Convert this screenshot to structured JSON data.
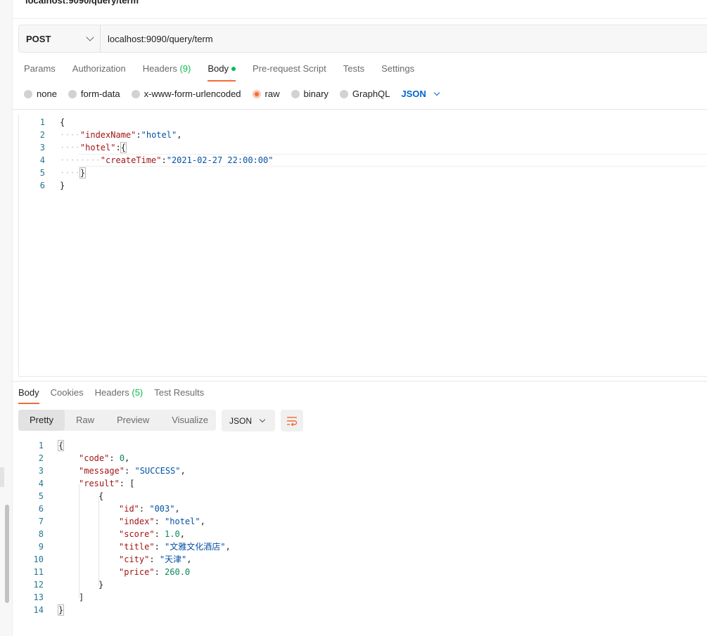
{
  "request_title": "localhost:9090/query/term",
  "request": {
    "method": "POST",
    "url": "localhost:9090/query/term"
  },
  "request_tabs": {
    "params": "Params",
    "authorization": "Authorization",
    "headers_label": "Headers",
    "headers_count": "(9)",
    "body": "Body",
    "prerequest": "Pre-request Script",
    "tests": "Tests",
    "settings": "Settings"
  },
  "body_types": {
    "none": "none",
    "form_data": "form-data",
    "urlencoded": "x-www-form-urlencoded",
    "raw": "raw",
    "binary": "binary",
    "graphql": "GraphQL",
    "selected": "raw",
    "format": "JSON"
  },
  "request_body_lines": [
    {
      "n": "1"
    },
    {
      "n": "2"
    },
    {
      "n": "3"
    },
    {
      "n": "4"
    },
    {
      "n": "5"
    },
    {
      "n": "6"
    }
  ],
  "request_body": {
    "key_indexName": "\"indexName\"",
    "val_indexName": "\"hotel\"",
    "key_hotel": "\"hotel\"",
    "key_createTime": "\"createTime\"",
    "val_createTime": "\"2021-02-27 22:00:00\""
  },
  "response_tabs": {
    "body": "Body",
    "cookies": "Cookies",
    "headers_label": "Headers",
    "headers_count": "(5)",
    "test_results": "Test Results"
  },
  "response_view": {
    "pretty": "Pretty",
    "raw": "Raw",
    "preview": "Preview",
    "visualize": "Visualize",
    "format": "JSON"
  },
  "response_body": {
    "key_code": "\"code\"",
    "val_code": "0",
    "key_message": "\"message\"",
    "val_message": "\"SUCCESS\"",
    "key_result": "\"result\"",
    "key_id": "\"id\"",
    "val_id": "\"003\"",
    "key_index": "\"index\"",
    "val_index": "\"hotel\"",
    "key_score": "\"score\"",
    "val_score": "1.0",
    "key_title": "\"title\"",
    "val_title": "\"文雅文化酒店\"",
    "key_city": "\"city\"",
    "val_city": "\"天津\"",
    "key_price": "\"price\"",
    "val_price": "260.0"
  },
  "response_line_numbers": [
    "1",
    "2",
    "3",
    "4",
    "5",
    "6",
    "7",
    "8",
    "9",
    "10",
    "11",
    "12",
    "13",
    "14"
  ],
  "colors": {
    "accent": "#f26b3a",
    "success": "#0cbb52",
    "link_blue": "#0265d2",
    "json_key": "#a31515",
    "json_string": "#0451a5",
    "json_number": "#098658"
  }
}
